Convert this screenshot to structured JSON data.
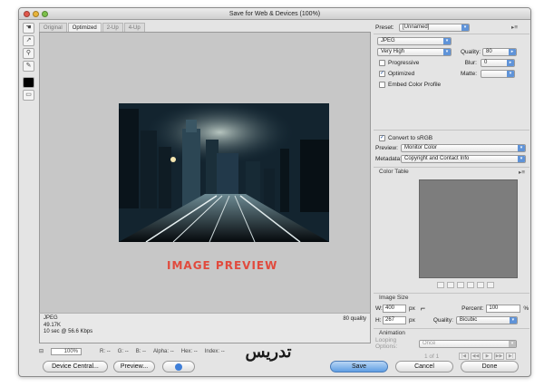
{
  "window": {
    "title": "Save for Web & Devices (100%)"
  },
  "tabs": [
    "Original",
    "Optimized",
    "2-Up",
    "4-Up"
  ],
  "tools": [
    {
      "icon": "hand-icon",
      "glyph": "☚"
    },
    {
      "icon": "slice-select-icon",
      "glyph": "↗"
    },
    {
      "icon": "zoom-icon",
      "glyph": "⚲"
    },
    {
      "icon": "eyedropper-icon",
      "glyph": "✎"
    },
    {
      "icon": "color-swatch-icon",
      "glyph": ""
    },
    {
      "icon": "toggle-slices-icon",
      "glyph": "▭"
    }
  ],
  "preview": {
    "caption": "IMAGE PREVIEW"
  },
  "info": {
    "format": "JPEG",
    "size": "49.17K",
    "time": "10 sec @ 56.6 Kbps",
    "quality": "80 quality"
  },
  "status": {
    "zoom": "100%",
    "r": "R: --",
    "g": "G: --",
    "b": "B: --",
    "alpha": "Alpha: --",
    "hex": "Hex: --",
    "index": "Index: --"
  },
  "buttons": {
    "device_central": "Device Central...",
    "preview": "Preview...",
    "save": "Save",
    "cancel": "Cancel",
    "done": "Done"
  },
  "panel": {
    "preset_label": "Preset:",
    "preset_value": "[Unnamed]",
    "format_value": "JPEG",
    "compression_value": "Very High",
    "quality_label": "Quality:",
    "quality_value": "80",
    "blur_label": "Blur:",
    "blur_value": "0",
    "matte_label": "Matte:",
    "progressive_label": "Progressive",
    "optimized_label": "Optimized",
    "embed_label": "Embed Color Profile",
    "convert_label": "Convert to sRGB",
    "preview_label": "Preview:",
    "preview_value": "Monitor Color",
    "metadata_label": "Metadata:",
    "metadata_value": "Copyright and Contact Info",
    "color_table_label": "Color Table",
    "image_size_label": "Image Size",
    "w_label": "W:",
    "w_value": "400",
    "h_label": "H:",
    "h_value": "267",
    "px": "px",
    "percent_label": "Percent:",
    "percent_value": "100",
    "percent_unit": "%",
    "quality2_label": "Quality:",
    "quality2_value": "Bicubic",
    "animation_label": "Animation",
    "looping_label": "Looping Options:",
    "looping_value": "Once",
    "frame_counter": "1 of 1"
  },
  "checks": {
    "progressive": false,
    "optimized": true,
    "embed": false,
    "convert": true
  },
  "watermark": {
    "text": "تدریس"
  },
  "colors": {
    "accent": "#5f93d8",
    "caption": "#e14a3d",
    "save_button": "#5f9ee3"
  }
}
